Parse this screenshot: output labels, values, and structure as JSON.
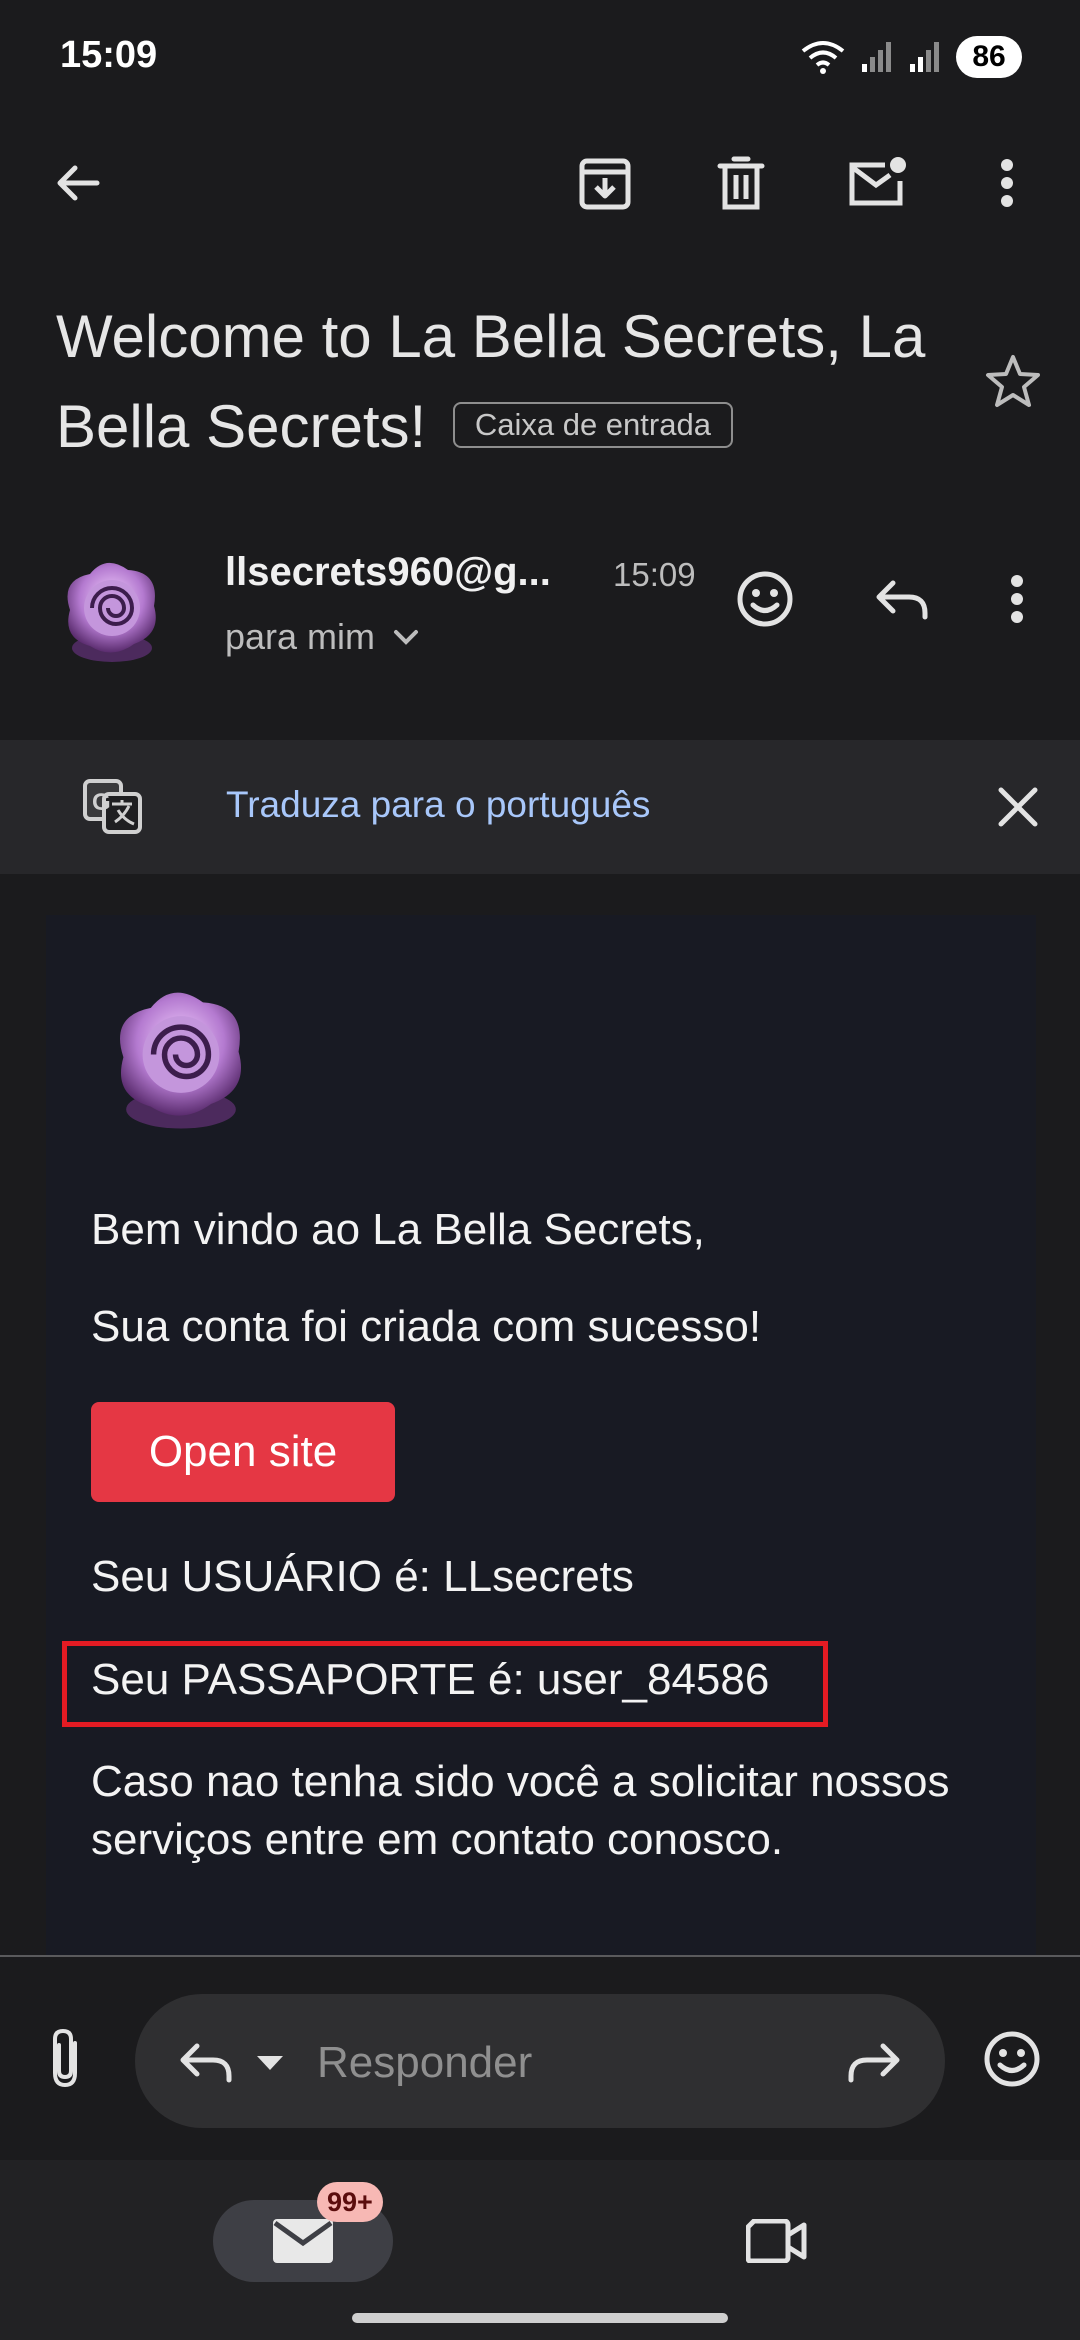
{
  "status_bar": {
    "time": "15:09",
    "battery": "86",
    "icons": [
      "wifi-icon",
      "signal-icon",
      "signal-icon"
    ]
  },
  "toolbar": {
    "icons": [
      "back-arrow-icon",
      "archive-icon",
      "trash-icon",
      "mark-unread-icon",
      "more-vert-icon"
    ]
  },
  "email": {
    "subject": "Welcome to La Bella Secrets, La Bella Secrets!",
    "label": "Caixa de entrada",
    "sender": "llsecrets960@g...",
    "time": "15:09",
    "to": "para mim"
  },
  "translate": {
    "text": "Traduza para o português"
  },
  "body": {
    "greeting": "Bem vindo ao La Bella Secrets,",
    "success": "Sua conta foi criada com sucesso!",
    "button": "Open site",
    "user_line": "Seu USUÁRIO é: LLsecrets",
    "password_line": "Seu PASSAPORTE é: user_84586",
    "note": "Caso nao tenha sido você a solicitar nossos serviços entre em contato conosco."
  },
  "reply": {
    "placeholder": "Responder"
  },
  "nav": {
    "badge": "99+"
  },
  "colors": {
    "background": "#1b1b1d",
    "link": "#a8c7fa",
    "button": "#e53744",
    "highlight": "#e31b23",
    "badge": "#f7b8b4"
  }
}
